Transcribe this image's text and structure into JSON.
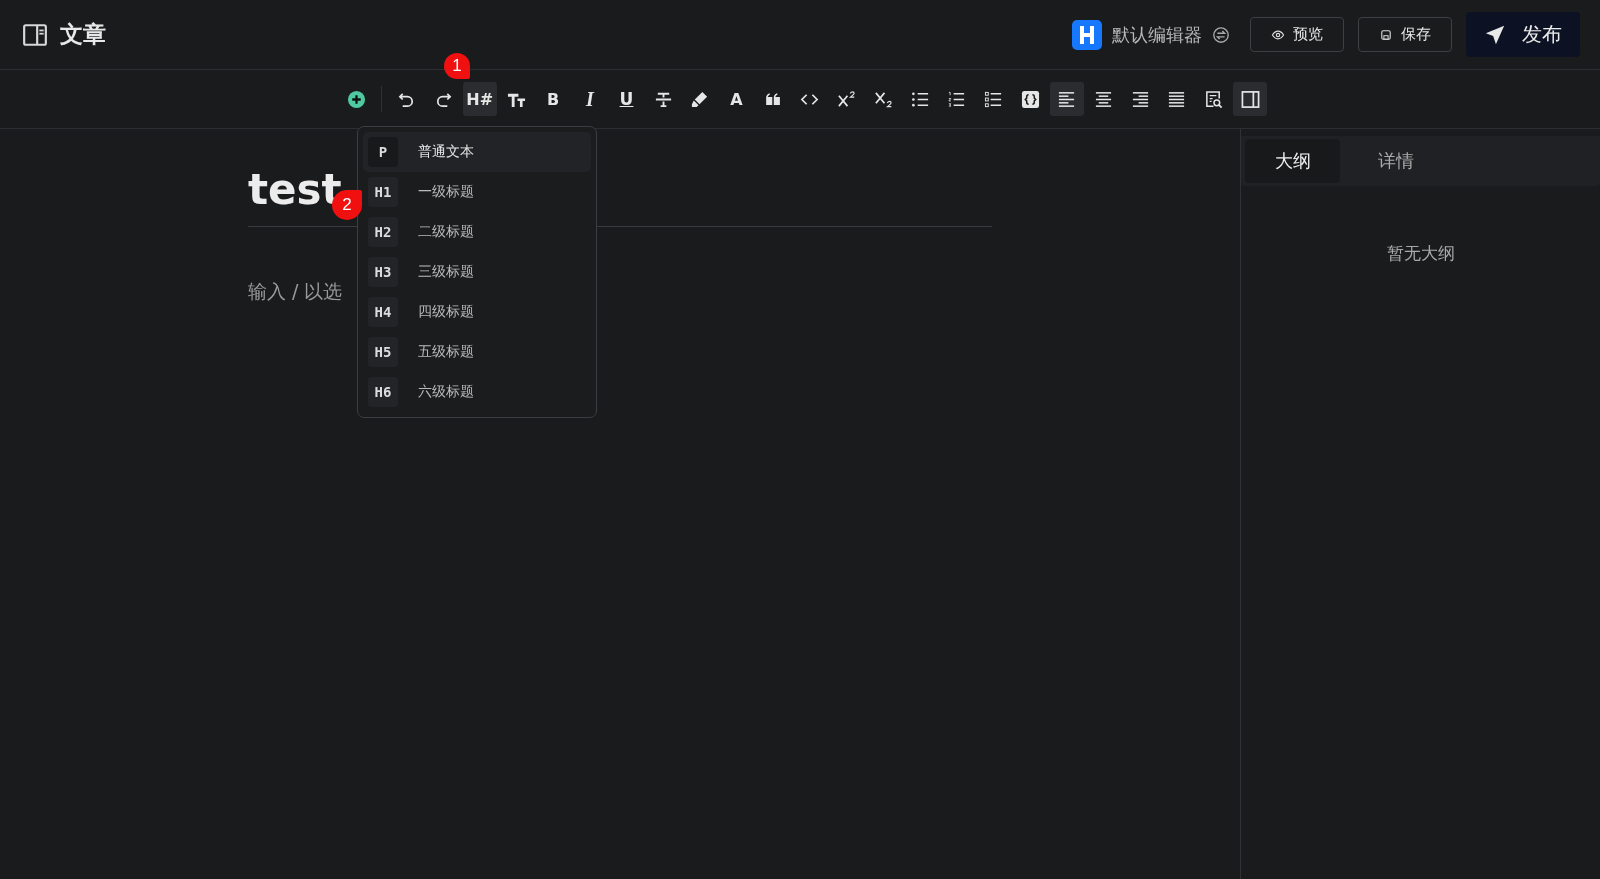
{
  "header": {
    "title": "文章",
    "editor_label": "默认编辑器",
    "buttons": [
      {
        "kind": "preview",
        "label": "预览"
      },
      {
        "kind": "save",
        "label": "保存"
      },
      {
        "kind": "publish",
        "label": "发布"
      }
    ]
  },
  "toolbar": [
    {
      "kind": "add",
      "active": false
    },
    {
      "kind": "undo",
      "active": false
    },
    {
      "kind": "redo",
      "active": false
    },
    {
      "kind": "text",
      "label": "H#",
      "active": true
    },
    {
      "kind": "fontsize",
      "active": false
    },
    {
      "kind": "text",
      "label": "B",
      "active": false
    },
    {
      "kind": "italic",
      "label": "I",
      "active": false
    },
    {
      "kind": "underline",
      "label": "U",
      "active": false
    },
    {
      "kind": "strike",
      "active": false
    },
    {
      "kind": "highlight",
      "active": false
    },
    {
      "kind": "text",
      "label": "A",
      "active": false
    },
    {
      "kind": "quote",
      "active": false
    },
    {
      "kind": "code",
      "active": false
    },
    {
      "kind": "sup",
      "active": false
    },
    {
      "kind": "sub",
      "active": false
    },
    {
      "kind": "ul",
      "active": false
    },
    {
      "kind": "ol",
      "active": false
    },
    {
      "kind": "task",
      "active": false
    },
    {
      "kind": "codeblock",
      "active": false
    },
    {
      "kind": "align-left",
      "active": true
    },
    {
      "kind": "align-center",
      "active": false
    },
    {
      "kind": "align-right",
      "active": false
    },
    {
      "kind": "justify",
      "active": false
    },
    {
      "kind": "search-doc",
      "active": false
    },
    {
      "kind": "sidebar",
      "active": true
    }
  ],
  "heading_menu": [
    {
      "tag": "P",
      "label": "普通文本",
      "selected": true
    },
    {
      "tag": "H1",
      "label": "一级标题",
      "selected": false
    },
    {
      "tag": "H2",
      "label": "二级标题",
      "selected": false
    },
    {
      "tag": "H3",
      "label": "三级标题",
      "selected": false
    },
    {
      "tag": "H4",
      "label": "四级标题",
      "selected": false
    },
    {
      "tag": "H5",
      "label": "五级标题",
      "selected": false
    },
    {
      "tag": "H6",
      "label": "六级标题",
      "selected": false
    }
  ],
  "editor": {
    "title": "test",
    "placeholder": "输入 / 以选"
  },
  "side_panel": {
    "tabs": [
      {
        "label": "大纲",
        "selected": true
      },
      {
        "label": "详情",
        "selected": false
      }
    ],
    "empty_text": "暂无大纲"
  },
  "annotations": [
    {
      "label": "1"
    },
    {
      "label": "2"
    }
  ]
}
